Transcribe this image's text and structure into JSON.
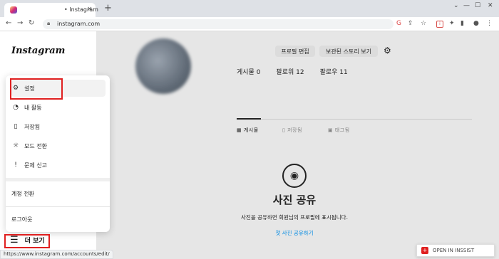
{
  "browser": {
    "tab_title": "• Instagram",
    "tab_close": "×",
    "new_tab": "+",
    "url": "instagram.com",
    "status_url": "https://www.instagram.com/accounts/edit/",
    "window_controls": [
      "—",
      "☐",
      "✕"
    ]
  },
  "sidebar": {
    "logo": "Instagram",
    "more_label": "더 보기"
  },
  "menu": {
    "items": [
      {
        "label": "설정",
        "icon": "gear-icon",
        "glyph": "⚙"
      },
      {
        "label": "내 활동",
        "icon": "activity-icon",
        "glyph": "◔"
      },
      {
        "label": "저장됨",
        "icon": "bookmark-icon",
        "glyph": "▯"
      },
      {
        "label": "모드 전환",
        "icon": "sun-icon",
        "glyph": "☼"
      },
      {
        "label": "문제 신고",
        "icon": "report-icon",
        "glyph": "!"
      }
    ],
    "switch_account": "계정 전환",
    "logout": "로그아웃"
  },
  "profile": {
    "edit_profile": "프로필 편집",
    "view_archive": "보관된 스토리 보기",
    "posts": "게시물 0",
    "followers": "팔로워 12",
    "following": "팔로우 11"
  },
  "profile_tabs": [
    "게시물",
    "저장됨",
    "태그됨"
  ],
  "empty_state": {
    "title": "사진 공유",
    "description": "사진을 공유하면 회원님의 프로필에 표시됩니다.",
    "link": "첫 사진 공유하기"
  },
  "extension": {
    "label": "OPEN IN INSSIST"
  },
  "colors": {
    "highlight": "#e02020",
    "link": "#0095f6"
  }
}
